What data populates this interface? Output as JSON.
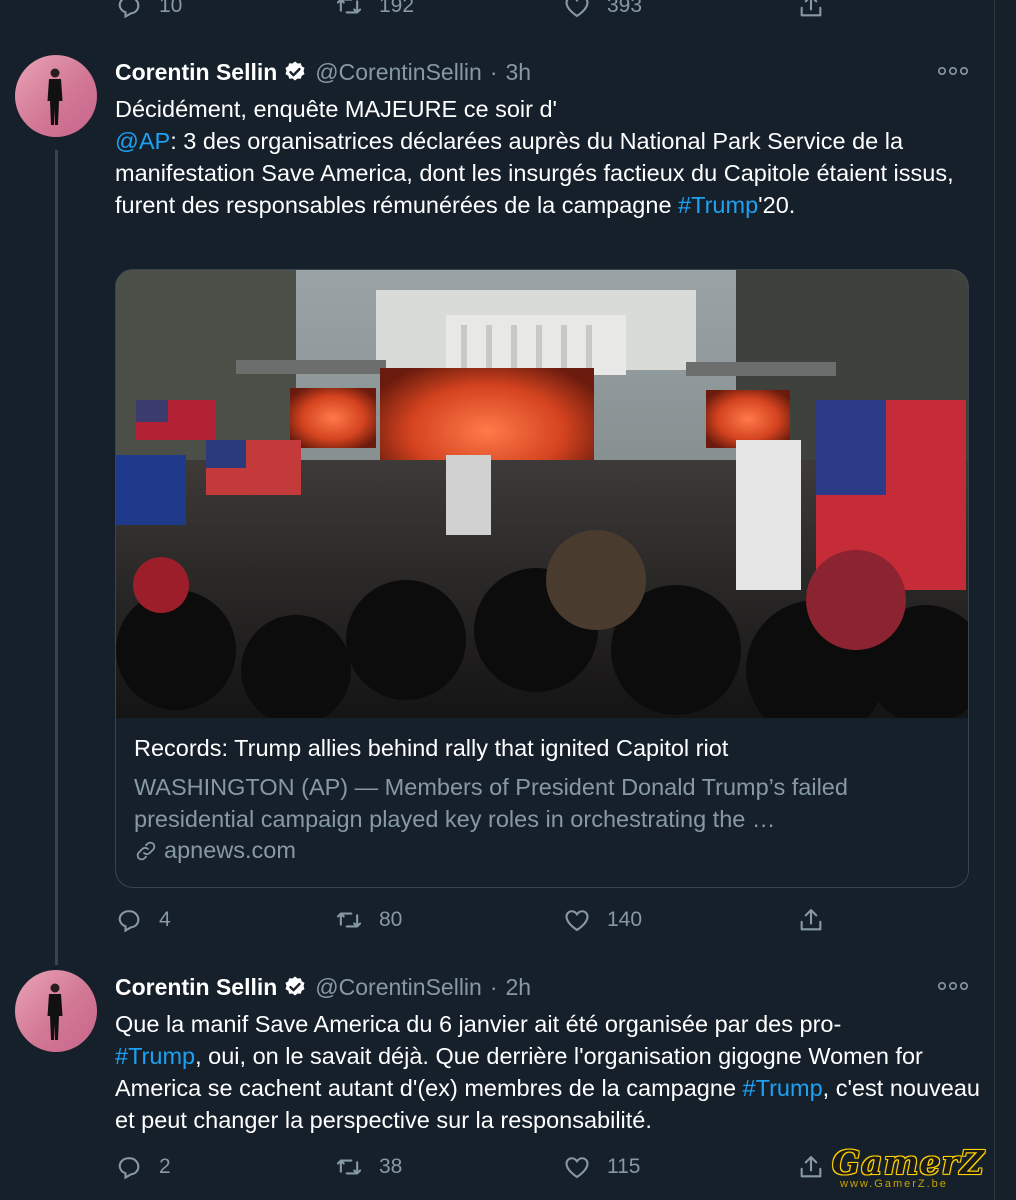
{
  "top_actions": {
    "replies": "10",
    "retweets": "192",
    "likes": "393"
  },
  "tweet1": {
    "author": "Corentin Sellin",
    "handle": "@CorentinSellin",
    "sep": "·",
    "time": "3h",
    "text_parts": [
      "Décidément, enquête MAJEURE ce soir d'",
      "@AP",
      ": 3 des organisatrices déclarées auprès du National Park Service de la manifestation Save America, dont les insurgés factieux du Capitole étaient issus, furent des responsables rémunérées de la campagne ",
      "#Trump",
      "'20."
    ],
    "card": {
      "title": "Records: Trump allies behind rally that ignited Capitol riot",
      "description": "WASHINGTON (AP) — Members of President Donald Trump’s failed presidential campaign played key roles in orchestrating the …",
      "domain": "apnews.com"
    },
    "actions": {
      "replies": "4",
      "retweets": "80",
      "likes": "140"
    }
  },
  "tweet2": {
    "author": "Corentin Sellin",
    "handle": "@CorentinSellin",
    "sep": "·",
    "time": "2h",
    "text_parts": [
      "Que la manif Save America du 6 janvier ait été organisée par des pro-",
      "#Trump",
      ", oui, on le savait déjà. Que derrière l'organisation gigogne Women for America se cachent autant d'(ex) membres de la campagne ",
      "#Trump",
      ", c'est nouveau et peut changer la perspective sur la responsabilité."
    ],
    "actions": {
      "replies": "2",
      "retweets": "38"
    }
  },
  "watermark": {
    "text": "GamerZ",
    "sub": "www.GamerZ.be"
  },
  "colors": {
    "background": "#15202b",
    "link": "#1da1f2",
    "secondary": "#8899a6",
    "border": "#38444d"
  },
  "icons": [
    "reply-icon",
    "retweet-icon",
    "like-icon",
    "share-icon",
    "verified-icon",
    "more-icon",
    "link-icon"
  ]
}
